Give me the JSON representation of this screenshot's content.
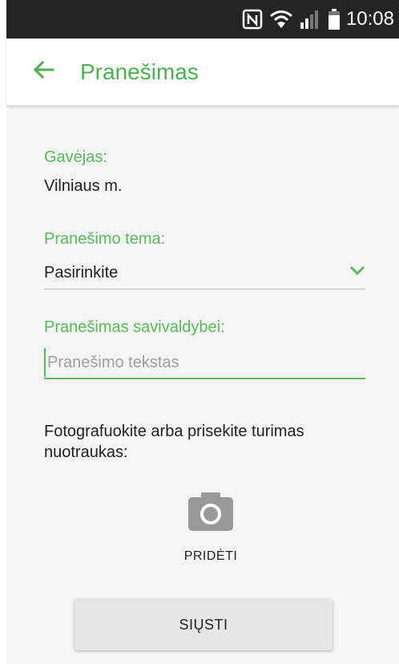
{
  "status_bar": {
    "time": "10:08",
    "icons": [
      "nfc-icon",
      "wifi-icon",
      "signal-icon",
      "battery-icon"
    ]
  },
  "app_bar": {
    "back_icon": "arrow-left-icon",
    "title": "Pranešimas"
  },
  "form": {
    "recipient_label": "Gavėjas:",
    "recipient_value": "Vilniaus m.",
    "topic_label": "Pranešimo tema:",
    "topic_value": "Pasirinkite",
    "message_label": "Pranešimas savivaldybei:",
    "message_value": "",
    "message_placeholder": "Pranešimo tekstas",
    "photo_instruction": "Fotografuokite arba prisekite turimas nuotraukas:",
    "add_photo_label": "PRIDĖTI",
    "send_label": "SIŲSTI"
  },
  "colors": {
    "accent": "#5cb85c",
    "title": "#4caf50",
    "status_bar": "#242424",
    "background": "#f5f5f5"
  }
}
